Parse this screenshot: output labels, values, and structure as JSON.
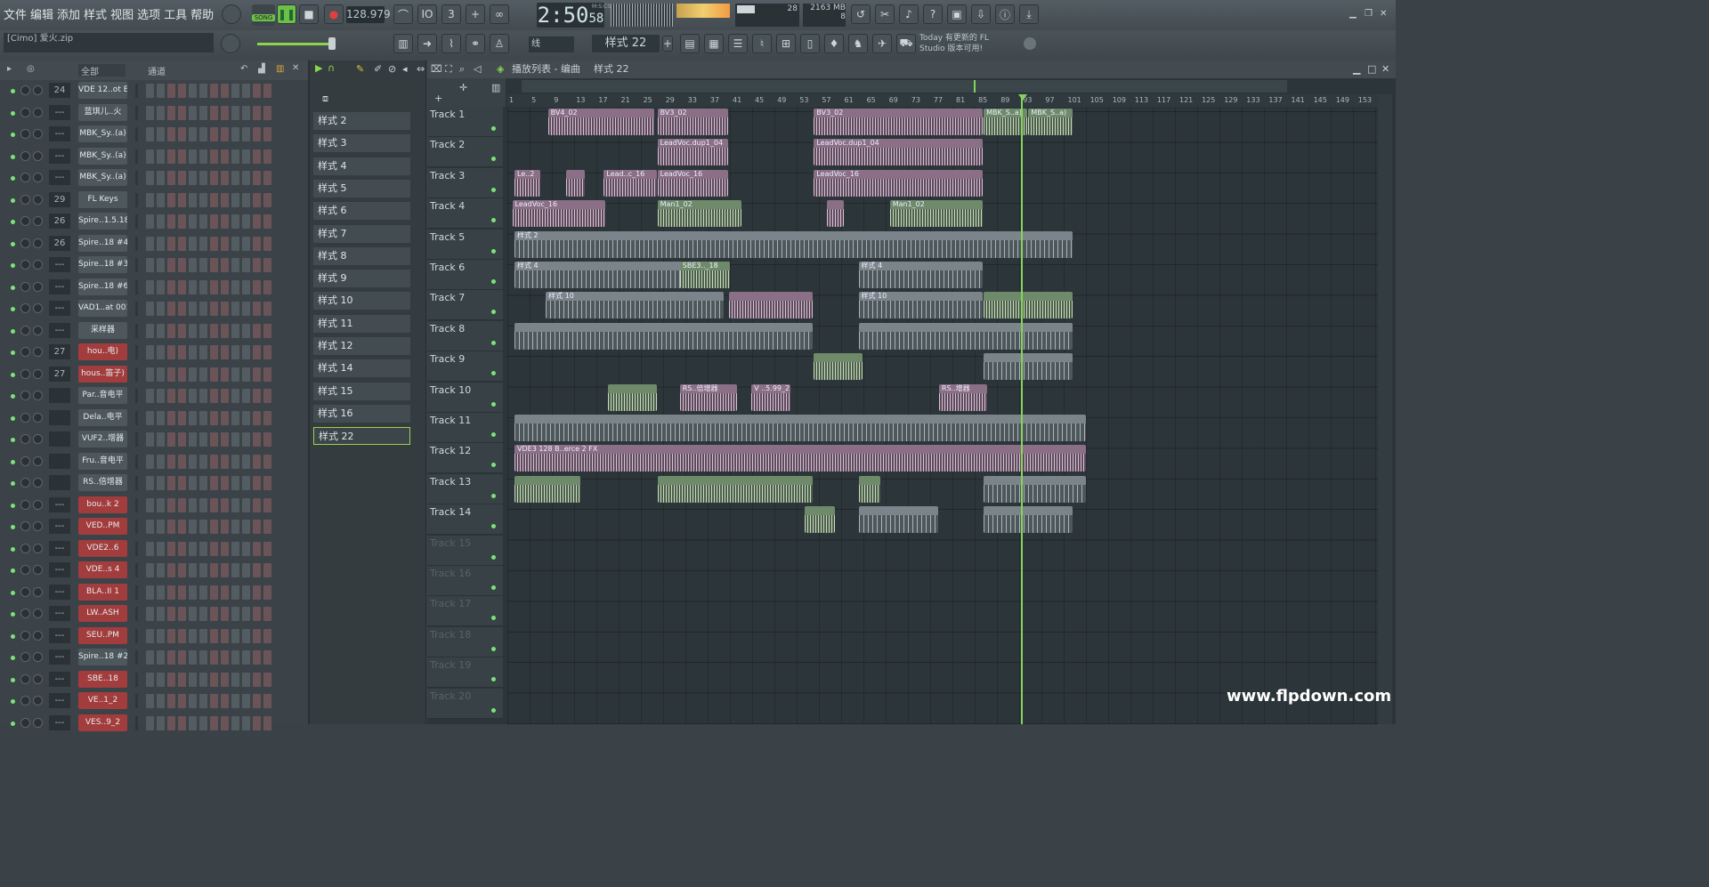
{
  "menu": [
    "文件",
    "编辑",
    "添加",
    "样式",
    "视图",
    "选项",
    "工具",
    "帮助"
  ],
  "transport": {
    "mode": "SONG",
    "bpm": "128.979",
    "time": "2:50",
    "time_small": "58",
    "time_unit": "M:S:CS",
    "cpu": "28",
    "mem": "2163 MB",
    "voices": "8"
  },
  "hint_bar": "[Cimo] 爱火.zip",
  "tool_row": {
    "snap": "线",
    "pattern": "样式 22"
  },
  "news": {
    "line1": "Today  有更新的 FL",
    "line2": "Studio 版本可用!"
  },
  "rack": {
    "filter": "全部",
    "title": "通道"
  },
  "channels": [
    {
      "num": "24",
      "name": "VDE 12..ot E",
      "red": false
    },
    {
      "num": "---",
      "name": "蓝琪儿..火",
      "red": false
    },
    {
      "num": "---",
      "name": "MBK_Sy..(a)",
      "red": false
    },
    {
      "num": "---",
      "name": "MBK_Sy..(a)",
      "red": false
    },
    {
      "num": "---",
      "name": "MBK_Sy..(a)",
      "red": false
    },
    {
      "num": "29",
      "name": "FL Keys",
      "red": false
    },
    {
      "num": "26",
      "name": "Spire..1.5.18",
      "red": false
    },
    {
      "num": "26",
      "name": "Spire..18 #4",
      "red": false
    },
    {
      "num": "---",
      "name": "Spire..18 #3",
      "red": false
    },
    {
      "num": "---",
      "name": "Spire..18 #6",
      "red": false
    },
    {
      "num": "---",
      "name": "VAD1..at 001",
      "red": false
    },
    {
      "num": "---",
      "name": "采样器",
      "red": false
    },
    {
      "num": "27",
      "name": "hou..电)",
      "red": true
    },
    {
      "num": "27",
      "name": "hous..笛子)",
      "red": true
    },
    {
      "num": "",
      "name": "Par..音电平",
      "red": false
    },
    {
      "num": "",
      "name": "Dela..电平",
      "red": false
    },
    {
      "num": "",
      "name": "VUF2..增器",
      "red": false
    },
    {
      "num": "",
      "name": "Fru..音电平",
      "red": false
    },
    {
      "num": "",
      "name": "RS..倍增器",
      "red": false
    },
    {
      "num": "---",
      "name": "bou..k 2",
      "red": true
    },
    {
      "num": "---",
      "name": "VED..PM",
      "red": true
    },
    {
      "num": "---",
      "name": "VDE2..6",
      "red": true
    },
    {
      "num": "---",
      "name": "VDE..s 4",
      "red": true
    },
    {
      "num": "---",
      "name": "BLA..II 1",
      "red": true
    },
    {
      "num": "---",
      "name": "LW..ASH",
      "red": true
    },
    {
      "num": "---",
      "name": "SEU..PM",
      "red": true
    },
    {
      "num": "---",
      "name": "Spire..18 #2",
      "red": false
    },
    {
      "num": "---",
      "name": "SBE..18",
      "red": true
    },
    {
      "num": "---",
      "name": "VE..1_2",
      "red": true
    },
    {
      "num": "---",
      "name": "VES..9_2",
      "red": true
    }
  ],
  "patterns": [
    "样式 2",
    "样式 3",
    "样式 4",
    "样式 5",
    "样式 6",
    "样式 7",
    "样式 8",
    "样式 9",
    "样式 10",
    "样式 11",
    "样式 12",
    "样式 14",
    "样式 15",
    "样式 16",
    "样式 22"
  ],
  "playlist": {
    "title": "播放列表 - 编曲",
    "crumb": "样式 22"
  },
  "ruler": [
    "1",
    "5",
    "9",
    "13",
    "17",
    "21",
    "25",
    "29",
    "33",
    "37",
    "41",
    "45",
    "49",
    "53",
    "57",
    "61",
    "65",
    "69",
    "73",
    "77",
    "81",
    "85",
    "89",
    "93",
    "97",
    "101",
    "105",
    "109",
    "113",
    "117",
    "121",
    "125",
    "129",
    "133",
    "137",
    "141",
    "145",
    "149",
    "153"
  ],
  "tracks": [
    "Track 1",
    "Track 2",
    "Track 3",
    "Track 4",
    "Track 5",
    "Track 6",
    "Track 7",
    "Track 8",
    "Track 9",
    "Track 10",
    "Track 11",
    "Track 12",
    "Track 13",
    "Track 14",
    "Track 15",
    "Track 16",
    "Track 17",
    "Track 18",
    "Track 19",
    "Track 20"
  ],
  "clips": [
    {
      "t": 0,
      "s": 1.7,
      "e": 6.5,
      "c": "cv",
      "l": "BV4_02"
    },
    {
      "t": 0,
      "s": 6.6,
      "e": 9.8,
      "c": "cv",
      "l": "BV3_02"
    },
    {
      "t": 0,
      "s": 13.6,
      "e": 21.2,
      "c": "cv",
      "l": "BV3_02"
    },
    {
      "t": 0,
      "s": 21.2,
      "e": 23.2,
      "c": "cg",
      "l": "MBK_S..a)"
    },
    {
      "t": 0,
      "s": 23.2,
      "e": 25.2,
      "c": "cg",
      "l": "MBK_S..a)"
    },
    {
      "t": 1,
      "s": 6.6,
      "e": 9.8,
      "c": "cv",
      "l": "LeadVoc.dup1_04"
    },
    {
      "t": 1,
      "s": 13.6,
      "e": 21.2,
      "c": "cv",
      "l": "LeadVoc.dup1_04"
    },
    {
      "t": 2,
      "s": 0.2,
      "e": 1.4,
      "c": "cv",
      "l": "Le..2"
    },
    {
      "t": 2,
      "s": 2.5,
      "e": 3.4,
      "c": "cv",
      "l": ""
    },
    {
      "t": 2,
      "s": 4.2,
      "e": 6.6,
      "c": "cv",
      "l": "Lead..c_16"
    },
    {
      "t": 2,
      "s": 6.6,
      "e": 9.8,
      "c": "cv",
      "l": "LeadVoc_16"
    },
    {
      "t": 2,
      "s": 13.6,
      "e": 21.2,
      "c": "cv",
      "l": "LeadVoc_16"
    },
    {
      "t": 3,
      "s": 0.1,
      "e": 4.3,
      "c": "cv",
      "l": "LeadVoc_16"
    },
    {
      "t": 3,
      "s": 6.6,
      "e": 10.4,
      "c": "cg",
      "l": "Man1_02"
    },
    {
      "t": 3,
      "s": 14.2,
      "e": 15.0,
      "c": "cv",
      "l": ""
    },
    {
      "t": 3,
      "s": 17.0,
      "e": 21.2,
      "c": "cg",
      "l": "Man1_02"
    },
    {
      "t": 4,
      "s": 0.2,
      "e": 25.2,
      "c": "cp",
      "l": "样式 2"
    },
    {
      "t": 5,
      "s": 0.2,
      "e": 9.9,
      "c": "cp",
      "l": "样式 4"
    },
    {
      "t": 5,
      "s": 7.6,
      "e": 9.9,
      "c": "cg",
      "l": "SBE3.._18"
    },
    {
      "t": 5,
      "s": 15.6,
      "e": 21.2,
      "c": "cp",
      "l": "样式 4"
    },
    {
      "t": 6,
      "s": 1.6,
      "e": 9.6,
      "c": "cp",
      "l": "样式 10"
    },
    {
      "t": 6,
      "s": 9.8,
      "e": 13.6,
      "c": "cv",
      "l": ""
    },
    {
      "t": 6,
      "s": 15.6,
      "e": 21.2,
      "c": "cp",
      "l": "样式 10"
    },
    {
      "t": 6,
      "s": 21.2,
      "e": 25.2,
      "c": "cg",
      "l": ""
    },
    {
      "t": 7,
      "s": 0.2,
      "e": 13.6,
      "c": "cp",
      "l": ""
    },
    {
      "t": 7,
      "s": 15.6,
      "e": 25.2,
      "c": "cp",
      "l": ""
    },
    {
      "t": 8,
      "s": 13.6,
      "e": 15.8,
      "c": "cg",
      "l": ""
    },
    {
      "t": 8,
      "s": 21.2,
      "e": 25.2,
      "c": "cp",
      "l": ""
    },
    {
      "t": 9,
      "s": 4.4,
      "e": 6.6,
      "c": "cg",
      "l": ""
    },
    {
      "t": 9,
      "s": 7.6,
      "e": 10.2,
      "c": "cv",
      "l": "RS..倍增器"
    },
    {
      "t": 9,
      "s": 10.8,
      "e": 12.6,
      "c": "cv",
      "l": "V ..5.99_2"
    },
    {
      "t": 9,
      "s": 19.2,
      "e": 21.4,
      "c": "cv",
      "l": "RS..增器"
    },
    {
      "t": 10,
      "s": 0.2,
      "e": 25.8,
      "c": "cp",
      "l": ""
    },
    {
      "t": 11,
      "s": 0.2,
      "e": 25.8,
      "c": "cv",
      "l": "VDE3 128 B..erce 2 FX"
    },
    {
      "t": 12,
      "s": 0.2,
      "e": 3.2,
      "c": "cg",
      "l": ""
    },
    {
      "t": 12,
      "s": 6.6,
      "e": 13.6,
      "c": "cg",
      "l": ""
    },
    {
      "t": 12,
      "s": 15.6,
      "e": 16.6,
      "c": "cg",
      "l": ""
    },
    {
      "t": 12,
      "s": 21.2,
      "e": 25.8,
      "c": "cp",
      "l": ""
    },
    {
      "t": 13,
      "s": 13.2,
      "e": 14.6,
      "c": "cg",
      "l": ""
    },
    {
      "t": 13,
      "s": 15.6,
      "e": 19.2,
      "c": "cp",
      "l": ""
    },
    {
      "t": 13,
      "s": 21.2,
      "e": 25.2,
      "c": "cp",
      "l": ""
    }
  ],
  "watermark": "www.flpdown.com"
}
